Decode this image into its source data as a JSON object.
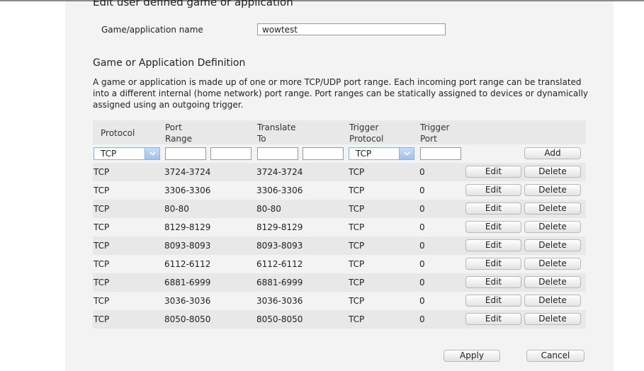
{
  "edit_heading": "Edit user defined game or application",
  "name_field": {
    "label": "Game/application name",
    "value": "wowtest"
  },
  "definition": {
    "heading": "Game or Application Definition",
    "description": "A game or application is made up of one or more TCP/UDP port range. Each incoming port range can be translated into a different internal (home network) port range. Port ranges can be statically assigned to devices or dynamically assigned using an outgoing trigger."
  },
  "table": {
    "headers": {
      "protocol": "Protocol",
      "port_range_1": "Port",
      "port_range_2": "Range",
      "translate_1": "Translate",
      "translate_2": "To",
      "trigger_protocol_1": "Trigger",
      "trigger_protocol_2": "Protocol",
      "trigger_port_1": "Trigger",
      "trigger_port_2": "Port"
    },
    "new_entry": {
      "protocol": "TCP",
      "trigger_protocol": "TCP",
      "add_label": "Add"
    },
    "edit_label": "Edit",
    "delete_label": "Delete",
    "rows": [
      {
        "protocol": "TCP",
        "port_range": "3724-3724",
        "translate_to": "3724-3724",
        "trigger_protocol": "TCP",
        "trigger_port": "0"
      },
      {
        "protocol": "TCP",
        "port_range": "3306-3306",
        "translate_to": "3306-3306",
        "trigger_protocol": "TCP",
        "trigger_port": "0"
      },
      {
        "protocol": "TCP",
        "port_range": "80-80",
        "translate_to": "80-80",
        "trigger_protocol": "TCP",
        "trigger_port": "0"
      },
      {
        "protocol": "TCP",
        "port_range": "8129-8129",
        "translate_to": "8129-8129",
        "trigger_protocol": "TCP",
        "trigger_port": "0"
      },
      {
        "protocol": "TCP",
        "port_range": "8093-8093",
        "translate_to": "8093-8093",
        "trigger_protocol": "TCP",
        "trigger_port": "0"
      },
      {
        "protocol": "TCP",
        "port_range": "6112-6112",
        "translate_to": "6112-6112",
        "trigger_protocol": "TCP",
        "trigger_port": "0"
      },
      {
        "protocol": "TCP",
        "port_range": "6881-6999",
        "translate_to": "6881-6999",
        "trigger_protocol": "TCP",
        "trigger_port": "0"
      },
      {
        "protocol": "TCP",
        "port_range": "3036-3036",
        "translate_to": "3036-3036",
        "trigger_protocol": "TCP",
        "trigger_port": "0"
      },
      {
        "protocol": "TCP",
        "port_range": "8050-8050",
        "translate_to": "8050-8050",
        "trigger_protocol": "TCP",
        "trigger_port": "0"
      }
    ]
  },
  "actions": {
    "apply_label": "Apply",
    "cancel_label": "Cancel"
  }
}
